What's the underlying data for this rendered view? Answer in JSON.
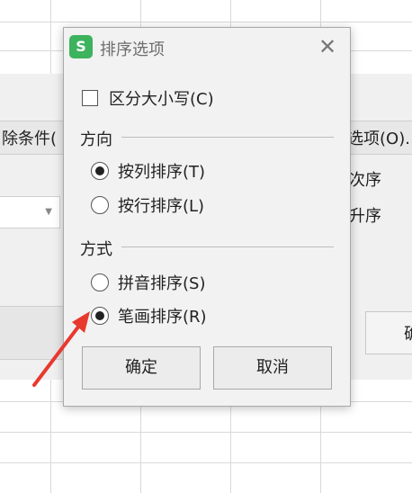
{
  "background": {
    "sort_dialog_texts": {
      "delete_condition": "除条件(",
      "options": "选项(O).",
      "order_header": "次序",
      "order_value": "升序",
      "confirm_partial": "确"
    }
  },
  "dialog": {
    "app_logo": "S",
    "title": "排序选项",
    "close_glyph": "✕",
    "case_sensitive": {
      "label": "区分大小写(C)",
      "checked": false
    },
    "direction": {
      "heading": "方向",
      "options": [
        {
          "label": "按列排序(T)",
          "selected": true
        },
        {
          "label": "按行排序(L)",
          "selected": false
        }
      ]
    },
    "method": {
      "heading": "方式",
      "options": [
        {
          "label": "拼音排序(S)",
          "selected": false
        },
        {
          "label": "笔画排序(R)",
          "selected": true
        }
      ]
    },
    "ok_label": "确定",
    "cancel_label": "取消"
  },
  "colors": {
    "logo_green": "#3db35e",
    "annotation_red": "#e8392f"
  }
}
